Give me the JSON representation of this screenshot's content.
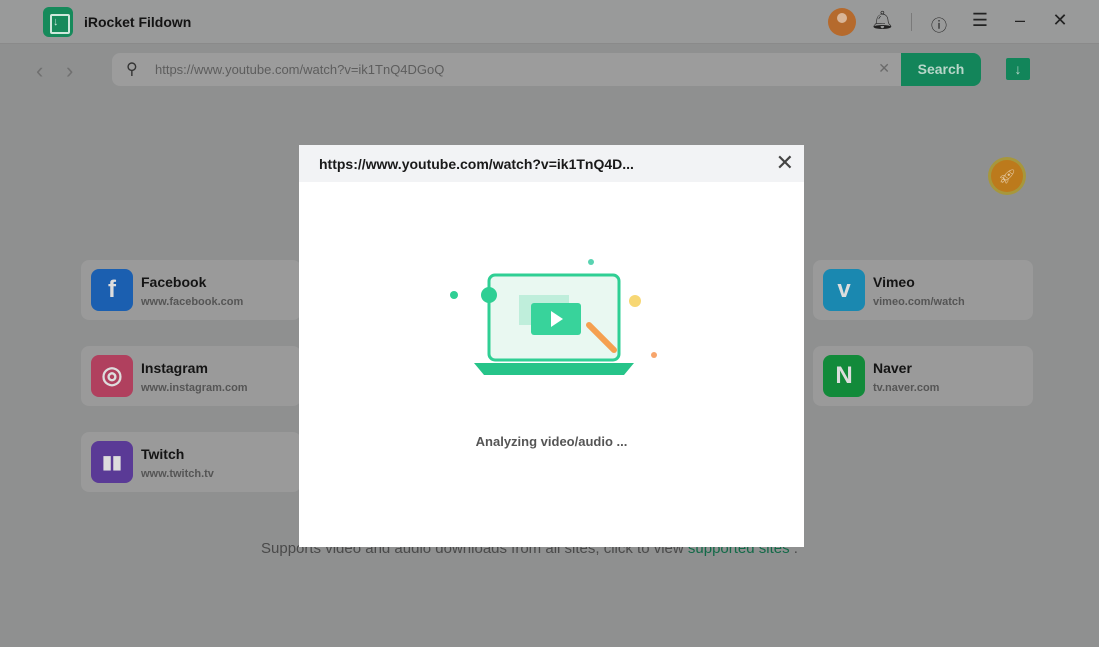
{
  "app": {
    "title": "iRocket Fildown"
  },
  "toolbar": {
    "url": "https://www.youtube.com/watch?v=ik1TnQ4DGoQ",
    "search_label": "Search"
  },
  "sites": [
    {
      "name": "Facebook",
      "domain": "www.facebook.com",
      "icon": "facebook-icon",
      "color": "#1b5fb0"
    },
    {
      "name": "Instagram",
      "domain": "www.instagram.com",
      "icon": "instagram-icon",
      "color": "#b0405e"
    },
    {
      "name": "Twitch",
      "domain": "www.twitch.tv",
      "icon": "twitch-icon",
      "color": "#5a3a96"
    },
    {
      "name": "Vimeo",
      "domain": "vimeo.com/watch",
      "icon": "vimeo-icon",
      "color": "#1a88b0"
    },
    {
      "name": "Naver",
      "domain": "tv.naver.com",
      "icon": "naver-icon",
      "color": "#128a3a"
    }
  ],
  "footer": {
    "text": "Supports video and audio downloads from all sites, click to view ",
    "link": "supported sites",
    "end": " ."
  },
  "modal": {
    "title": "https://www.youtube.com/watch?v=ik1TnQ4D...",
    "status": "Analyzing video/audio ..."
  },
  "colors": {
    "accent": "#00b074"
  }
}
